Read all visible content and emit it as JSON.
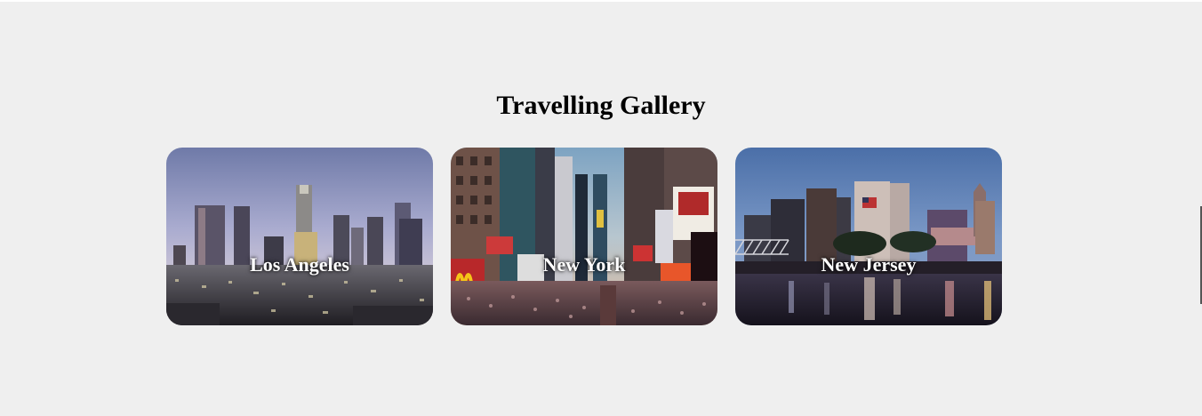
{
  "gallery": {
    "title": "Travelling Gallery",
    "cards": [
      {
        "label": "Los Angeles"
      },
      {
        "label": "New York"
      },
      {
        "label": "New Jersey"
      }
    ]
  },
  "colors": {
    "page_background": "#efefef",
    "title_text": "#000000",
    "card_label_text": "#ffffff"
  }
}
